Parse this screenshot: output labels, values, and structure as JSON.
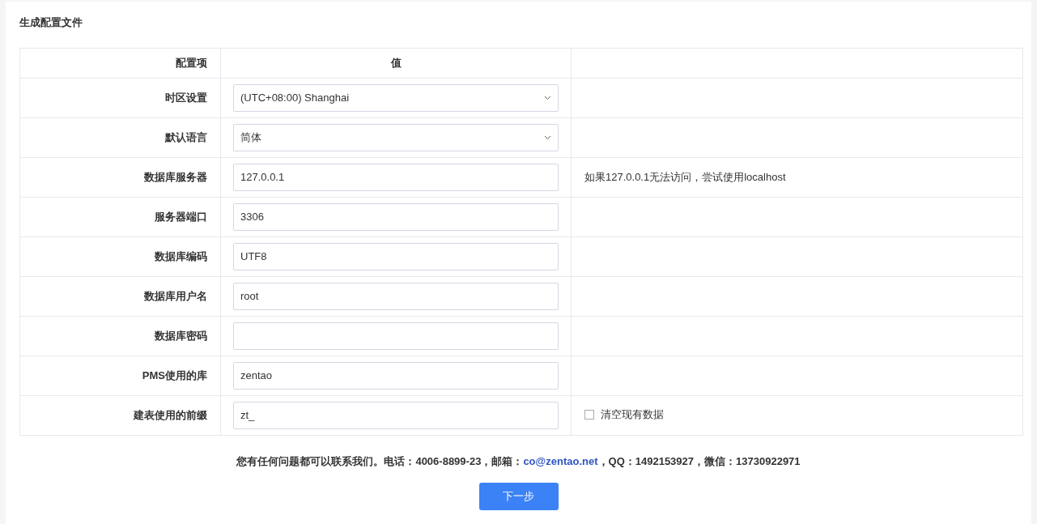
{
  "title": "生成配置文件",
  "table": {
    "columns": [
      "配置项",
      "值"
    ],
    "rows": [
      {
        "label": "时区设置",
        "kind": "select",
        "value": "(UTC+08:00) Shanghai"
      },
      {
        "label": "默认语言",
        "kind": "select",
        "value": "简体"
      },
      {
        "label": "数据库服务器",
        "kind": "input",
        "value": "127.0.0.1",
        "note": {
          "kind": "text",
          "text": "如果127.0.0.1无法访问，尝试使用localhost"
        }
      },
      {
        "label": "服务器端口",
        "kind": "input",
        "value": "3306"
      },
      {
        "label": "数据库编码",
        "kind": "input",
        "value": "UTF8"
      },
      {
        "label": "数据库用户名",
        "kind": "input",
        "value": "root"
      },
      {
        "label": "数据库密码",
        "kind": "input"
      },
      {
        "label": "PMS使用的库",
        "kind": "input",
        "value": "zentao"
      },
      {
        "label": "建表使用的前缀",
        "kind": "input",
        "value": "zt_",
        "note": {
          "kind": "checkbox",
          "text": "清空现有数据",
          "checked": false
        }
      }
    ]
  },
  "contact": {
    "before": "您有任何问题都可以联系我们。电话：4006-8899-23，邮箱：",
    "email": "co@zentao.net",
    "after": "，QQ：1492153927，微信：13730922971"
  },
  "next_button": "下一步"
}
